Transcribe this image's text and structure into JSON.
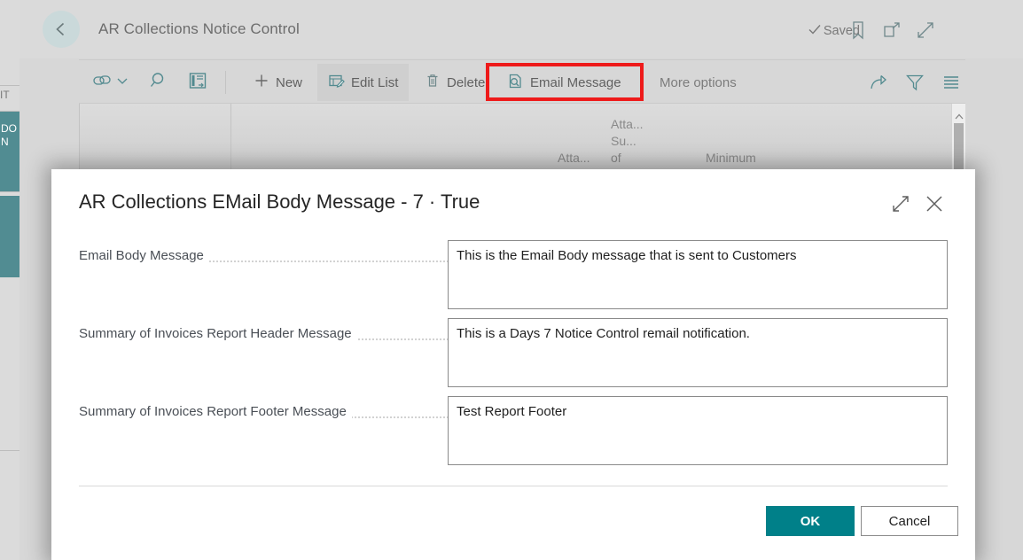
{
  "page": {
    "title": "AR Collections Notice Control",
    "back_icon": "back-arrow-icon",
    "saved_label": "Saved",
    "header_icons": [
      {
        "name": "bookmark-icon"
      },
      {
        "name": "open-in-new-window-icon"
      },
      {
        "name": "expand-icon"
      }
    ]
  },
  "ribbon": {
    "icon_buttons": [
      {
        "name": "share-link-icon",
        "label": ""
      },
      {
        "name": "chevron-down-icon",
        "label": ""
      },
      {
        "name": "search-icon",
        "label": ""
      },
      {
        "name": "page-layout-icon",
        "label": ""
      }
    ],
    "commands": [
      {
        "name": "new",
        "label": "New",
        "icon": "plus-icon",
        "active": false
      },
      {
        "name": "edit-list",
        "label": "Edit List",
        "icon": "edit-list-icon",
        "active": true
      },
      {
        "name": "delete",
        "label": "Delete",
        "icon": "trash-icon",
        "active": false
      },
      {
        "name": "email-message",
        "label": "Email Message",
        "icon": "document-search-icon",
        "active": false,
        "highlighted": true
      },
      {
        "name": "more-options",
        "label": "More options",
        "icon": "",
        "active": false
      }
    ],
    "right_icons": [
      {
        "name": "share-icon"
      },
      {
        "name": "filter-funnel-icon"
      },
      {
        "name": "list-view-icon"
      }
    ],
    "highlight_color": "#ec0000"
  },
  "grid": {
    "column_headers": [
      {
        "name": "attachment-col",
        "lines": [
          "Atta..."
        ]
      },
      {
        "name": "attachment-summary-of-col",
        "lines": [
          "Atta...",
          "Su...",
          "of"
        ]
      },
      {
        "name": "minimum-col",
        "lines": [
          "Minimum"
        ]
      }
    ],
    "scrollbar": {
      "name": "vertical-scrollbar",
      "up_arrow": "scroll-up-arrow-icon"
    }
  },
  "left_rail": {
    "fragments": [
      "IT",
      "DO",
      "N"
    ]
  },
  "dialog": {
    "title": "AR Collections EMail Body Message - 7 · True",
    "expand_icon": "expand-dialog-icon",
    "close_icon": "close-icon",
    "fields": [
      {
        "name": "email-body-message",
        "label": "Email Body Message",
        "value": "This is the Email Body message that is sent to Customers",
        "placeholder": ""
      },
      {
        "name": "summary-invoices-header-message",
        "label": "Summary of Invoices Report Header Message",
        "value": "This is a Days 7 Notice Control remail notification.",
        "placeholder": ""
      },
      {
        "name": "summary-invoices-footer-message",
        "label": "Summary of Invoices Report Footer Message",
        "value": "Test Report Footer",
        "placeholder": ""
      }
    ],
    "ok_label": "OK",
    "cancel_label": "Cancel",
    "accent_color": "#008089"
  }
}
